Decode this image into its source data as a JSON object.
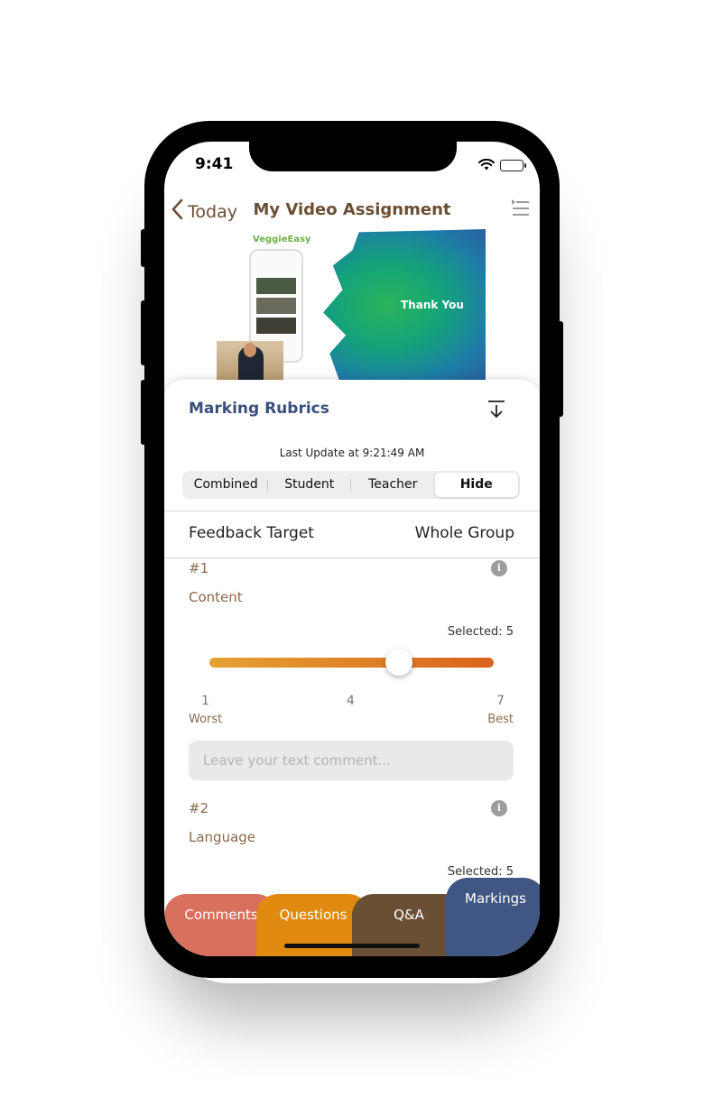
{
  "status": {
    "time": "9:41"
  },
  "nav": {
    "back_label": "Today",
    "title": "My Video Assignment"
  },
  "video": {
    "brand": "VeggieEasy",
    "slide_text": "Thank You"
  },
  "rubric": {
    "title": "Marking Rubrics",
    "last_update": "Last Update at 9:21:49 AM",
    "segments": [
      "Combined",
      "Student",
      "Teacher",
      "Hide"
    ],
    "active_segment": "Hide",
    "feedback_target_label": "Feedback Target",
    "feedback_target_value": "Whole Group",
    "items": [
      {
        "number": "#1",
        "name": "Content",
        "selected_text": "Selected: 5",
        "selected_value": 5,
        "min": 1,
        "mid": 4,
        "max": 7,
        "min_label": "1",
        "mid_label": "4",
        "max_label": "7",
        "worst_label": "Worst",
        "best_label": "Best",
        "comment_placeholder": "Leave your text comment..."
      },
      {
        "number": "#2",
        "name": "Language",
        "selected_text": "Selected: 5"
      }
    ]
  },
  "tabs": [
    {
      "label": "Comments",
      "color": "#d9705e"
    },
    {
      "label": "Questions",
      "color": "#e08a0f"
    },
    {
      "label": "Q&A",
      "color": "#6b4f35"
    },
    {
      "label": "Markings",
      "color": "#3f5782"
    }
  ],
  "colors": {
    "brown_accent": "#6b4f35",
    "navy_accent": "#3b4f7a",
    "slider_start": "#e5a233",
    "slider_end": "#d9641c"
  }
}
